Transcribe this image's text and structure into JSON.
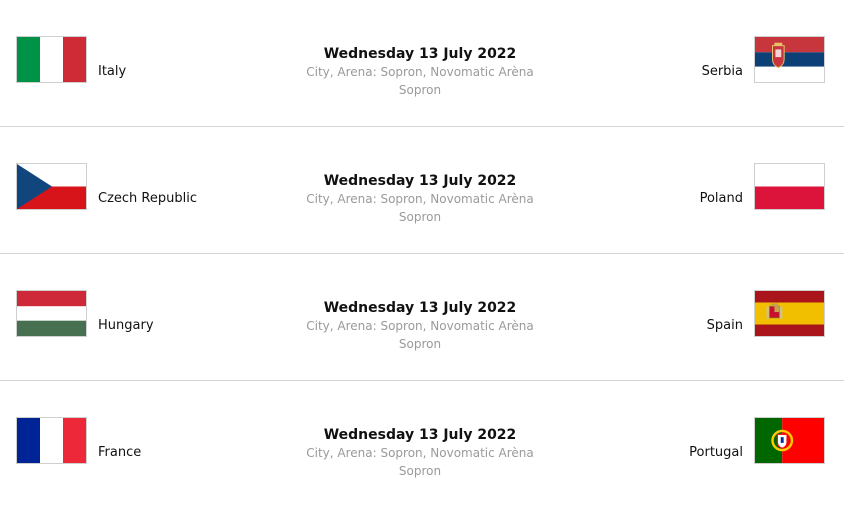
{
  "matches": [
    {
      "home": {
        "name": "Italy",
        "flag_icon": "italy-flag-icon",
        "colors": [
          "#009246",
          "#ffffff",
          "#ce2b37"
        ]
      },
      "away": {
        "name": "Serbia",
        "flag_icon": "serbia-flag-icon",
        "colors": [
          "#c6363c",
          "#0c4076",
          "#ffffff"
        ]
      },
      "date": "Wednesday 13 July 2022",
      "venue": "City, Arena: Sopron, Novomatic Arèna Sopron"
    },
    {
      "home": {
        "name": "Czech Republic",
        "flag_icon": "czech-republic-flag-icon",
        "colors": [
          "#ffffff",
          "#d7141a",
          "#11457e"
        ]
      },
      "away": {
        "name": "Poland",
        "flag_icon": "poland-flag-icon",
        "colors": [
          "#ffffff",
          "#dc143c"
        ]
      },
      "date": "Wednesday 13 July 2022",
      "venue": "City, Arena: Sopron, Novomatic Arèna Sopron"
    },
    {
      "home": {
        "name": "Hungary",
        "flag_icon": "hungary-flag-icon",
        "colors": [
          "#ce2939",
          "#ffffff",
          "#477050"
        ]
      },
      "away": {
        "name": "Spain",
        "flag_icon": "spain-flag-icon",
        "colors": [
          "#aa151b",
          "#f1bf00"
        ]
      },
      "date": "Wednesday 13 July 2022",
      "venue": "City, Arena: Sopron, Novomatic Arèna Sopron"
    },
    {
      "home": {
        "name": "France",
        "flag_icon": "france-flag-icon",
        "colors": [
          "#002395",
          "#ffffff",
          "#ed2939"
        ]
      },
      "away": {
        "name": "Portugal",
        "flag_icon": "portugal-flag-icon",
        "colors": [
          "#006600",
          "#ff0000",
          "#ffcc00"
        ]
      },
      "date": "Wednesday 13 July 2022",
      "venue": "City, Arena: Sopron, Novomatic Arèna Sopron"
    }
  ]
}
